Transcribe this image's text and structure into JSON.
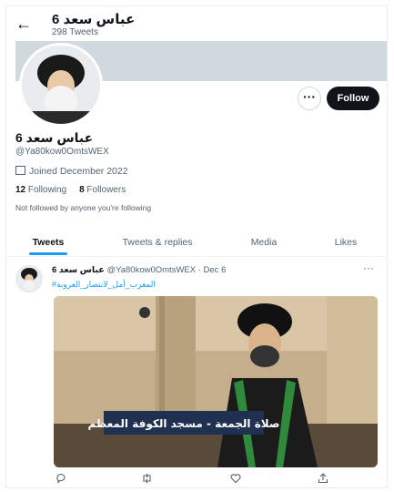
{
  "header": {
    "back_icon": "arrow-left-icon",
    "name": "عباس سعد 6",
    "tweet_count": "298 Tweets"
  },
  "profile": {
    "name": "عباس سعد 6",
    "handle": "@Ya80kow0OmtsWEX",
    "joined": "Joined December 2022",
    "following_count": "12",
    "following_label": "Following",
    "followers_count": "8",
    "followers_label": "Followers",
    "note": "Not followed by anyone you're following",
    "more_label": "···",
    "follow_label": "Follow"
  },
  "tabs": [
    {
      "label": "Tweets",
      "active": true
    },
    {
      "label": "Tweets & replies"
    },
    {
      "label": "Media"
    },
    {
      "label": "Likes"
    }
  ],
  "tweet": {
    "name": "عباس سعد 6",
    "handle_date": "@Ya80kow0OmtsWEX · Dec 6",
    "hashtag": "#المغرب_أمل_لانتصار_العروبة",
    "more": "···",
    "image_banner_text": "صلاة الجمعة - مسجد الكوفة المعظم",
    "actions": {
      "reply_icon": "reply-icon",
      "retweet_icon": "retweet-icon",
      "like_icon": "heart-icon",
      "share_icon": "share-icon"
    }
  },
  "colors": {
    "accent": "#1d9bf0",
    "banner": "#cfd9de",
    "dark": "#0f1419",
    "muted": "#536471"
  }
}
